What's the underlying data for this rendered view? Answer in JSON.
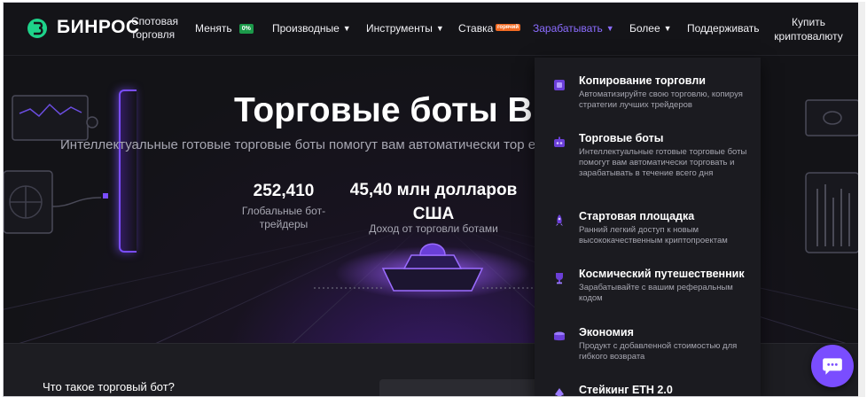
{
  "header": {
    "brand": "БИНРОС",
    "brand_sub": "Спотовая торговля",
    "nav": {
      "swap": "Менять",
      "swap_badge": "0%",
      "derivatives": "Производные",
      "tools": "Инструменты",
      "staking": "Ставка",
      "staking_badge": "горячий",
      "earn": "Зарабатывать",
      "more": "Более",
      "support": "Поддерживать"
    },
    "buy_crypto": "Купить криптовалюту"
  },
  "hero": {
    "title": "Торговые боты BII",
    "description": "Интеллектуальные готовые торговые боты помогут вам автоматически тор                                                  его дня",
    "stat1_value": "252,410",
    "stat1_label": "Глобальные бот-трейдеры",
    "stat2_value": "45,40 млн долларов США",
    "stat2_label": "Доход от торговли ботами"
  },
  "lower": {
    "question": "Что такое торговый бот?"
  },
  "dropdown": {
    "items": [
      {
        "title": "Копирование торговли",
        "desc": "Автоматизируйте свою торговлю, копируя стратегии лучших трейдеров",
        "icon": "copy-trade-icon"
      },
      {
        "title": "Торговые боты",
        "desc": "Интеллектуальные готовые торговые боты помогут вам автоматически торговать и зарабатывать в течение всего дня",
        "icon": "bot-icon"
      },
      {
        "title": "Стартовая площадка",
        "desc": "Ранний легкий доступ к новым высококачественным криптопроектам",
        "icon": "rocket-icon"
      },
      {
        "title": "Космический путешественник",
        "desc": "Зарабатывайте с вашим реферальным кодом",
        "icon": "trophy-icon"
      },
      {
        "title": "Экономия",
        "desc": "Продукт с добавленной стоимостью для гибкого возврата",
        "icon": "coins-icon"
      },
      {
        "title": "Стейкинг ETH 2.0",
        "desc": "",
        "icon": "eth-icon"
      }
    ]
  },
  "colors": {
    "accent": "#7a4dff",
    "background": "#141418",
    "dropdown": "#1b1b20",
    "badge_green": "#1c9a4a",
    "badge_orange": "#f26a22"
  }
}
